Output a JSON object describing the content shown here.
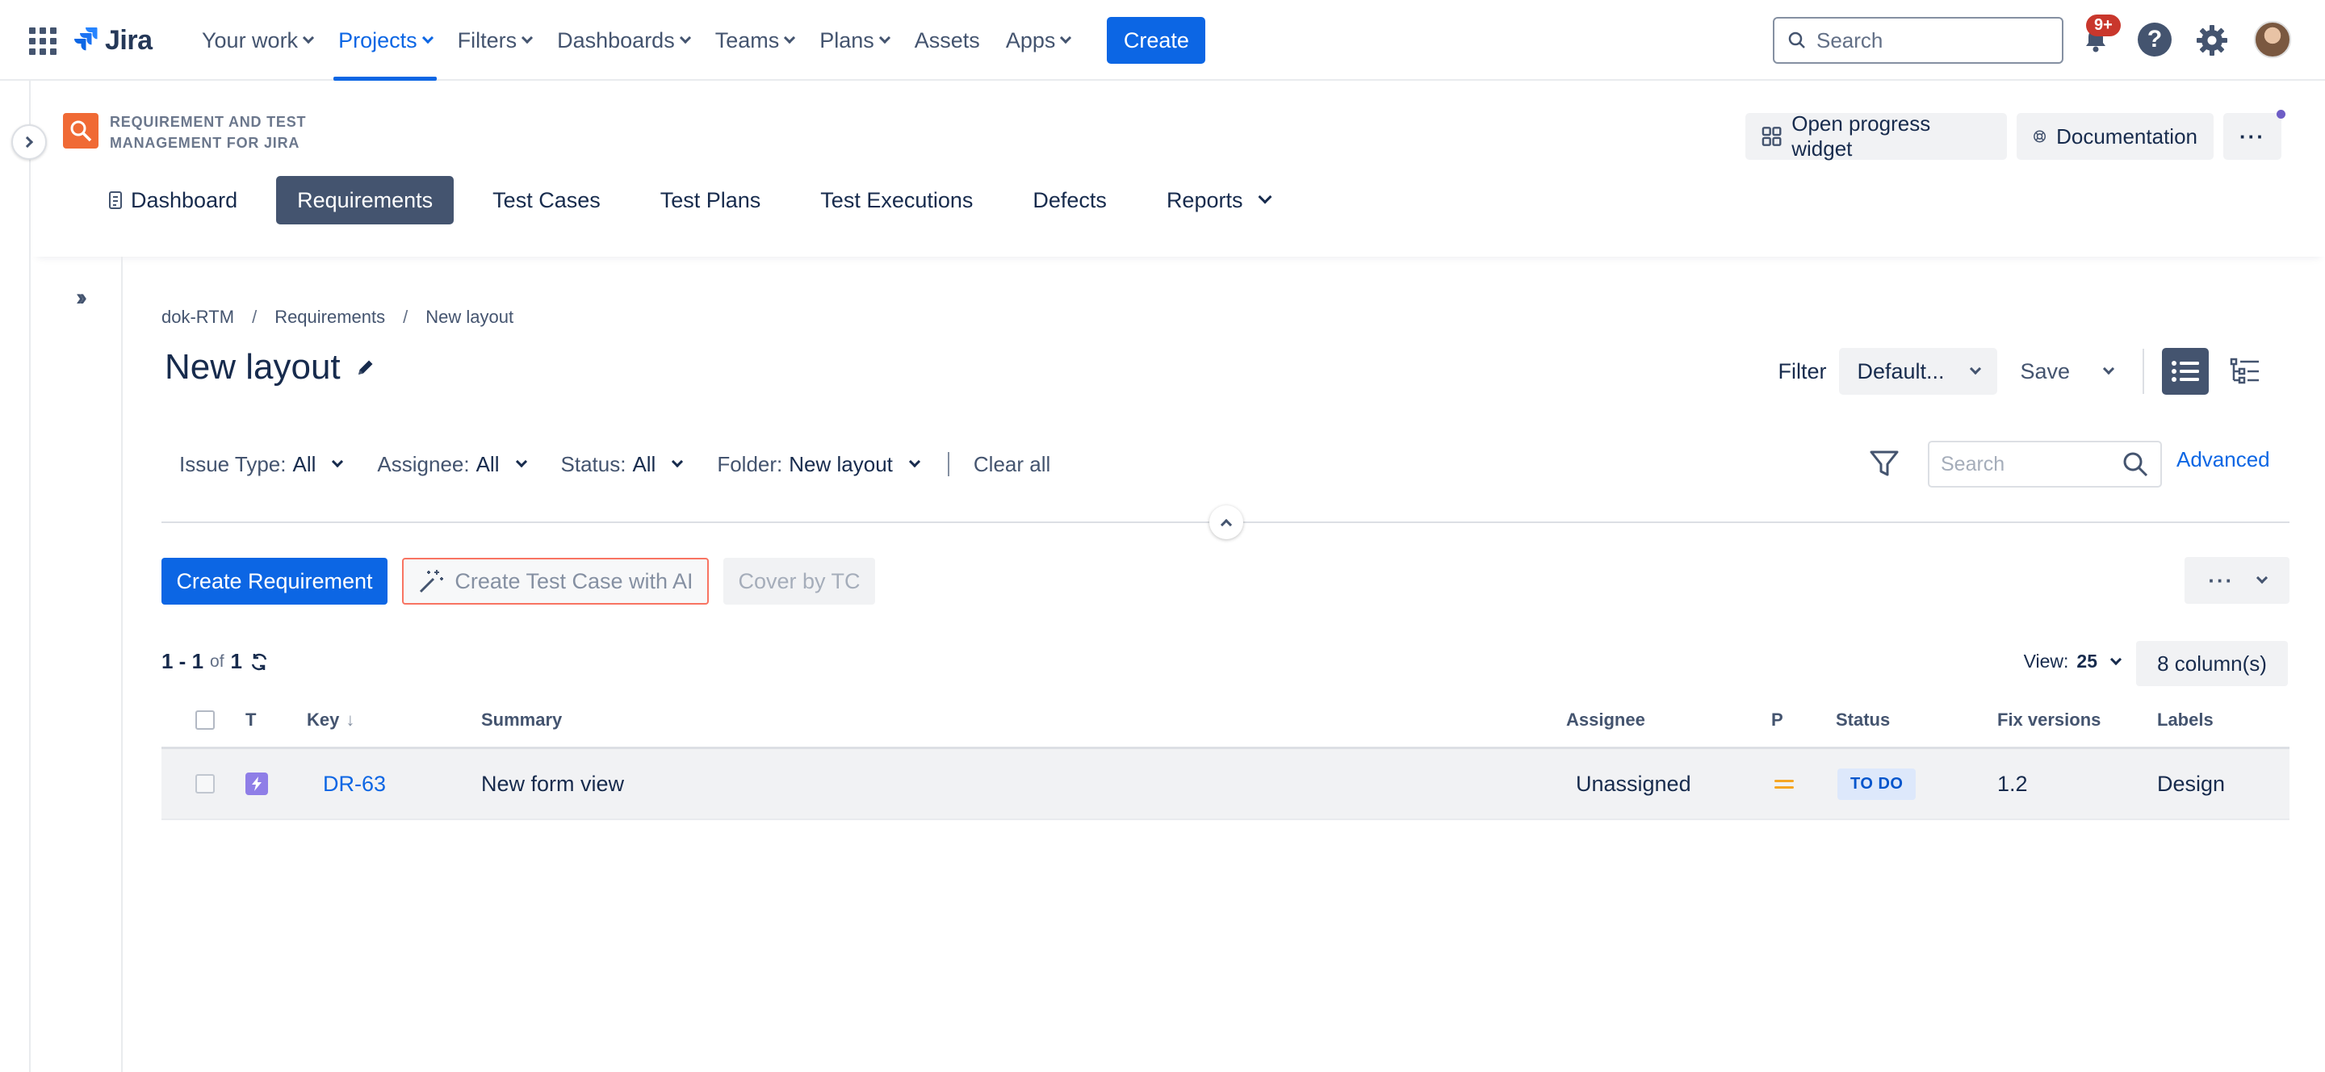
{
  "topnav": {
    "brand": "Jira",
    "items": [
      {
        "label": "Your work",
        "active": false
      },
      {
        "label": "Projects",
        "active": true
      },
      {
        "label": "Filters",
        "active": false
      },
      {
        "label": "Dashboards",
        "active": false
      },
      {
        "label": "Teams",
        "active": false
      },
      {
        "label": "Plans",
        "active": false
      },
      {
        "label": "Assets",
        "active": false
      },
      {
        "label": "Apps",
        "active": false
      }
    ],
    "create_label": "Create",
    "search_placeholder": "Search",
    "notif_badge": "9+"
  },
  "app": {
    "name_line1": "REQUIREMENT AND TEST",
    "name_line2": "MANAGEMENT FOR JIRA",
    "progress_label": "Open progress widget",
    "docs_label": "Documentation",
    "more_label": "···",
    "tabs": [
      "Dashboard",
      "Requirements",
      "Test Cases",
      "Test Plans",
      "Test Executions",
      "Defects",
      "Reports"
    ],
    "active_tab": "Requirements"
  },
  "breadcrumb": [
    "dok-RTM",
    "Requirements",
    "New layout"
  ],
  "page": {
    "title": "New layout",
    "filter_label": "Filter",
    "filter_value": "Default...",
    "save_label": "Save"
  },
  "filters": {
    "issue_type": {
      "label": "Issue Type:",
      "value": "All"
    },
    "assignee": {
      "label": "Assignee:",
      "value": "All"
    },
    "status": {
      "label": "Status:",
      "value": "All"
    },
    "folder": {
      "label": "Folder:",
      "value": "New layout"
    },
    "clear_all": "Clear all",
    "search_placeholder": "Search",
    "advanced": "Advanced"
  },
  "actions": {
    "create_requirement": "Create Requirement",
    "create_tc_ai": "Create Test Case with AI",
    "cover_by_tc": "Cover by TC",
    "more": "···"
  },
  "pagination": {
    "range": "1 - 1",
    "of_label": "of",
    "total": "1",
    "view_label": "View:",
    "view_value": "25",
    "columns_label": "8 column(s)"
  },
  "table": {
    "headers": {
      "type": "T",
      "key": "Key",
      "summary": "Summary",
      "assignee": "Assignee",
      "priority": "P",
      "status": "Status",
      "fix_versions": "Fix versions",
      "labels": "Labels"
    },
    "rows": [
      {
        "key": "DR-63",
        "summary": "New form view",
        "assignee": "Unassigned",
        "priority_icon": "medium-priority-icon",
        "status": "TO DO",
        "fix_versions": "1.2",
        "labels": "Design"
      }
    ]
  },
  "colors": {
    "accent": "#0c66e4",
    "active_tab": "#44546f",
    "app_logo": "#f06a35",
    "badge": "#c9372c",
    "type_icon": "#8f7ee7",
    "priority_medium": "#f5a623"
  }
}
